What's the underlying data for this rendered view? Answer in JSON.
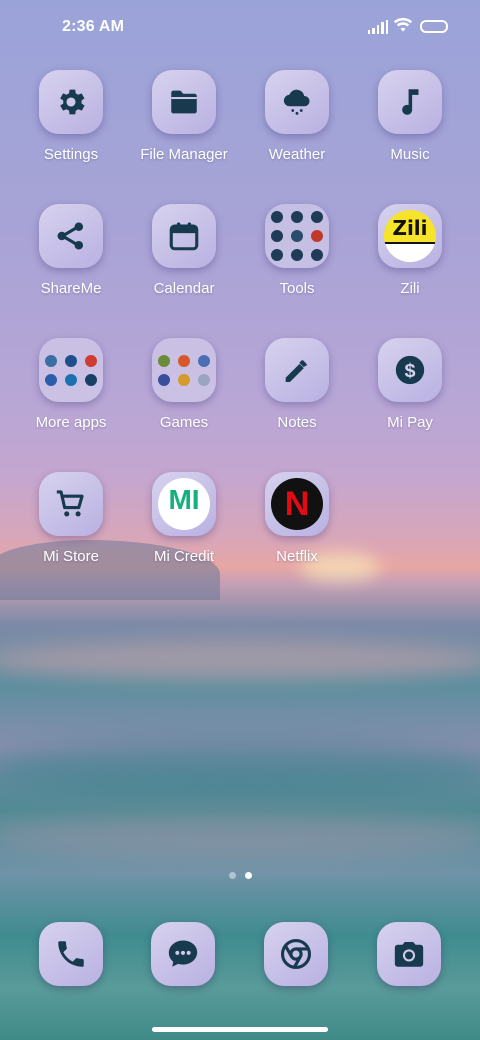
{
  "status_bar": {
    "time": "2:36 AM"
  },
  "colors": {
    "icon_glyph": "#173a4f",
    "label": "#ffffff"
  },
  "apps": [
    {
      "label": "Settings",
      "icon": "gear-icon"
    },
    {
      "label": "File Manager",
      "icon": "folder-icon"
    },
    {
      "label": "Weather",
      "icon": "cloud-rain-icon"
    },
    {
      "label": "Music",
      "icon": "music-note-icon"
    },
    {
      "label": "ShareMe",
      "icon": "share-icon"
    },
    {
      "label": "Calendar",
      "icon": "calendar-icon"
    },
    {
      "label": "Tools",
      "icon": "tools-folder-icon"
    },
    {
      "label": "Zili",
      "icon": "zili-logo-icon"
    },
    {
      "label": "More apps",
      "icon": "more-apps-folder-icon"
    },
    {
      "label": "Games",
      "icon": "games-folder-icon"
    },
    {
      "label": "Notes",
      "icon": "pencil-icon"
    },
    {
      "label": "Mi Pay",
      "icon": "dollar-coin-icon"
    },
    {
      "label": "Mi Store",
      "icon": "cart-icon"
    },
    {
      "label": "Mi Credit",
      "icon": "mi-credit-logo-icon"
    },
    {
      "label": "Netflix",
      "icon": "netflix-logo-icon"
    }
  ],
  "logos": {
    "zili": "Zili",
    "mi_credit": "MI",
    "netflix": "N"
  },
  "page_indicator": {
    "pages": 2,
    "current": 2
  },
  "dock": [
    {
      "icon": "phone-icon"
    },
    {
      "icon": "messages-icon"
    },
    {
      "icon": "chrome-icon"
    },
    {
      "icon": "camera-icon"
    }
  ]
}
